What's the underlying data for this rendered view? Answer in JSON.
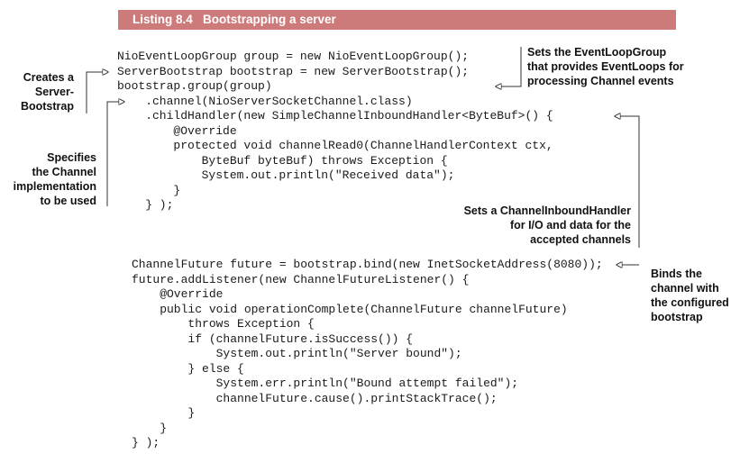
{
  "listing": {
    "title": "Listing 8.4   Bootstrapping a server"
  },
  "code": {
    "block1": "NioEventLoopGroup group = new NioEventLoopGroup();\nServerBootstrap bootstrap = new ServerBootstrap();\nbootstrap.group(group)\n    .channel(NioServerSocketChannel.class)\n    .childHandler(new SimpleChannelInboundHandler<ByteBuf>() {\n        @Override\n        protected void channelRead0(ChannelHandlerContext ctx,\n            ByteBuf byteBuf) throws Exception {\n            System.out.println(\"Received data\");\n        }\n    } );",
    "block2": "ChannelFuture future = bootstrap.bind(new InetSocketAddress(8080));\nfuture.addListener(new ChannelFutureListener() {\n    @Override\n    public void operationComplete(ChannelFuture channelFuture)\n        throws Exception {\n        if (channelFuture.isSuccess()) {\n            System.out.println(\"Server bound\");\n        } else {\n            System.err.println(\"Bound attempt failed\");\n            channelFuture.cause().printStackTrace();\n        }\n    }\n} );"
  },
  "annotations": {
    "creates_bootstrap": "Creates a\nServer-\nBootstrap",
    "sets_event_loop_group": "Sets the EventLoopGroup\nthat provides EventLoops for\nprocessing Channel events",
    "specifies_channel": "Specifies\nthe Channel\nimplementation\nto be used",
    "sets_inbound_handler": "Sets a ChannelInboundHandler\nfor I/O and data for the\naccepted channels",
    "binds_channel": "Binds the\nchannel with\nthe configured\nbootstrap"
  },
  "colors": {
    "listing_bar": "#cc7a7a",
    "listing_text": "#ffffff",
    "code_text": "#1a1a1a",
    "annotation_text": "#111111"
  }
}
